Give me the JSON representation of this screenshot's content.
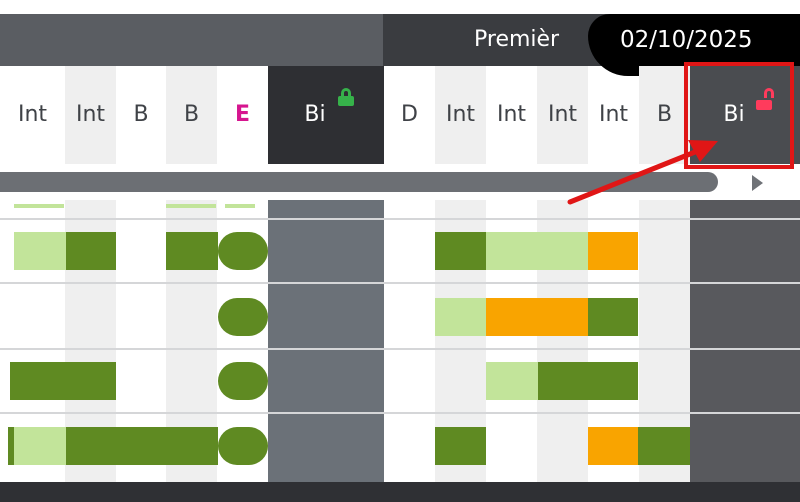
{
  "header": {
    "month_label": "Premièr",
    "date": "02/10/2025"
  },
  "columns": [
    {
      "label": "Int"
    },
    {
      "label": "Int"
    },
    {
      "label": "B"
    },
    {
      "label": "B"
    },
    {
      "label": "E"
    },
    {
      "label": "Bi",
      "lock": "locked"
    },
    {
      "label": "D"
    },
    {
      "label": "Int"
    },
    {
      "label": "Int"
    },
    {
      "label": "Int"
    },
    {
      "label": "Int"
    },
    {
      "label": "B"
    },
    {
      "label": "Bi",
      "lock": "unlocked"
    }
  ],
  "colors": {
    "dark_green": "#5f8a22",
    "light_green": "#c2e49a",
    "orange": "#f9a400",
    "lock_locked": "#36b24a",
    "lock_unlocked": "#ff3b5c",
    "annotation_red": "#e01616"
  },
  "icons": [
    "lock-closed-icon",
    "lock-open-icon",
    "scroll-right-arrow-icon"
  ]
}
